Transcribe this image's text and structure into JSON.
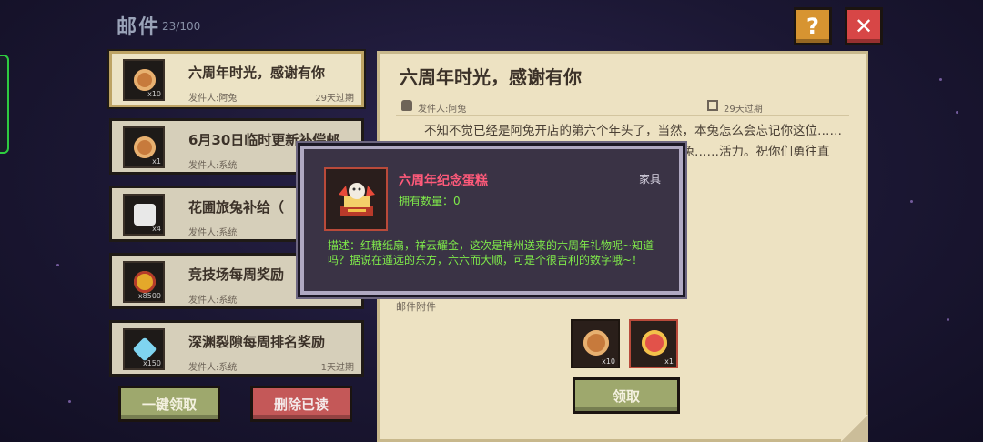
{
  "header": {
    "title": "邮件",
    "count": "23/100",
    "help_label": "?",
    "close_label": "✕"
  },
  "mail_list": [
    {
      "title": "六周年时光，感谢有你",
      "sender": "发件人:阿兔",
      "expire": "29天过期",
      "qty": "x10",
      "icon": "cake-box-icon",
      "selected": true
    },
    {
      "title": "6月30日临时更新补偿邮",
      "sender": "发件人:系统",
      "expire": "",
      "qty": "x1",
      "icon": "cake-box-icon",
      "selected": false
    },
    {
      "title": "花圃旅兔补给（",
      "sender": "发件人:系统",
      "expire": "",
      "qty": "x4",
      "icon": "dice-icon",
      "selected": false
    },
    {
      "title": "竞技场每周奖励",
      "sender": "发件人:系统",
      "expire": "",
      "qty": "x8500",
      "icon": "medal-icon",
      "selected": false
    },
    {
      "title": "深渊裂隙每周排名奖励",
      "sender": "发件人:系统",
      "expire": "1天过期",
      "qty": "x150",
      "icon": "gem-icon",
      "selected": false
    }
  ],
  "buttons": {
    "claim_all": "一键领取",
    "delete_read": "删除已读",
    "claim": "领取"
  },
  "detail": {
    "title": "六周年时光，感谢有你",
    "sender": "发件人:阿兔",
    "expire": "29天过期",
    "body": "不知不觉已经是阿兔开店的第六个年头了，当然，本兔怎么会忘记你这位……都新奇，看什么都想买，……好的朋友。谢谢你对阿兔……活力。祝你们勇往直前，",
    "attachments_label": "邮件附件",
    "attachments": [
      {
        "icon": "cake-box-icon",
        "qty": "x10"
      },
      {
        "icon": "anniversary-cake-icon",
        "qty": "x1"
      }
    ]
  },
  "popup": {
    "name": "六周年纪念蛋糕",
    "type": "家具",
    "owned": "拥有数量：0",
    "description": "描述：红糖纸扇，祥云耀金，这次是神州送来的六周年礼物呢~知道吗？据说在遥远的东方，六六而大顺，可是个很吉利的数字哦~！"
  },
  "colors": {
    "accent_green": "#7fea4a",
    "item_name_red": "#ff5a7a",
    "claim_button": "#9ea86d",
    "delete_button": "#c45858",
    "help_button": "#d79431",
    "close_button": "#d74646"
  }
}
